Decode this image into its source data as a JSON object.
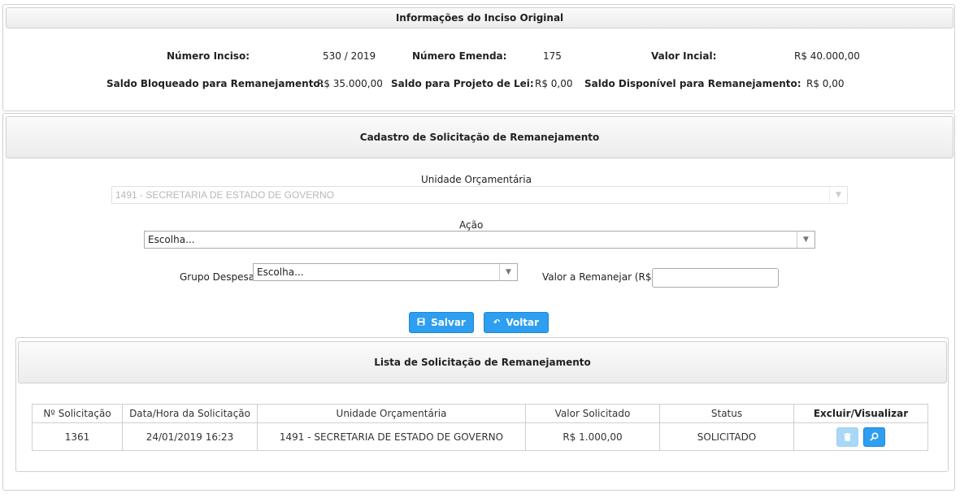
{
  "inciso": {
    "title": "Informações do Inciso Original",
    "numero_inciso_label": "Número Inciso:",
    "numero_inciso_value": "530 / 2019",
    "numero_emenda_label": "Número Emenda:",
    "numero_emenda_value": "175",
    "valor_inicial_label": "Valor Incial:",
    "valor_inicial_value": "R$ 40.000,00",
    "saldo_bloqueado_label": "Saldo Bloqueado para Remanejamento:",
    "saldo_bloqueado_value": "R$ 35.000,00",
    "saldo_projeto_label": "Saldo para Projeto de Lei:",
    "saldo_projeto_value": "R$ 0,00",
    "saldo_disponivel_label": "Saldo Disponível para Remanejamento:",
    "saldo_disponivel_value": "R$ 0,00"
  },
  "cadastro": {
    "title": "Cadastro de Solicitação de Remanejamento",
    "unidade_label": "Unidade Orçamentária",
    "unidade_value": "1491 - SECRETARIA DE ESTADO DE GOVERNO",
    "acao_label": "Ação",
    "acao_value": "Escolha...",
    "grupo_label": "Grupo Despesa",
    "grupo_value": "Escolha...",
    "valor_label": "Valor a Remanejar (R$)",
    "valor_value": "",
    "salvar_label": "Salvar",
    "voltar_label": "Voltar"
  },
  "lista": {
    "title": "Lista de Solicitação de Remanejamento",
    "columns": [
      "Nº Solicitação",
      "Data/Hora da Solicitação",
      "Unidade Orçamentária",
      "Valor Solicitado",
      "Status",
      "Excluir/Visualizar"
    ],
    "rows": [
      {
        "numero": "1361",
        "data_hora": "24/01/2019 16:23",
        "unidade": "1491 - SECRETARIA DE ESTADO DE GOVERNO",
        "valor": "R$ 1.000,00",
        "status": "SOLICITADO"
      }
    ]
  },
  "icons": {
    "save": "floppy-icon",
    "back": "undo-arrow-icon",
    "delete": "trash-icon",
    "view": "magnifier-icon",
    "dropdown": "chevron-down-icon"
  },
  "colors": {
    "accent": "#2e9ef0",
    "accent_light": "#a8d8f6",
    "border": "#cfcfcf"
  }
}
